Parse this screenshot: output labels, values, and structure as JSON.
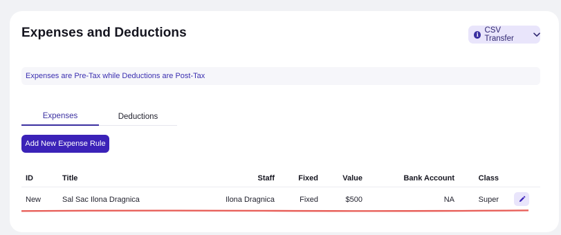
{
  "header": {
    "title": "Expenses and Deductions",
    "csv_button_label": "CSV Transfer"
  },
  "note": {
    "text": "Expenses are Pre-Tax while Deductions are Post-Tax"
  },
  "tabs": [
    {
      "label": "Expenses",
      "active": true
    },
    {
      "label": "Deductions",
      "active": false
    }
  ],
  "actions": {
    "add_label": "Add New Expense Rule"
  },
  "table": {
    "columns": [
      "ID",
      "Title",
      "Staff",
      "Fixed",
      "Value",
      "Bank Account",
      "Class"
    ],
    "rows": [
      [
        "New",
        "Sal Sac Ilona Dragnica",
        "Ilona Dragnica",
        "Fixed",
        "$500",
        "NA",
        "Super"
      ]
    ]
  },
  "colors": {
    "accent": "#3b22b8",
    "accent_light": "#e9e5fb",
    "underline": "#e8605a"
  }
}
